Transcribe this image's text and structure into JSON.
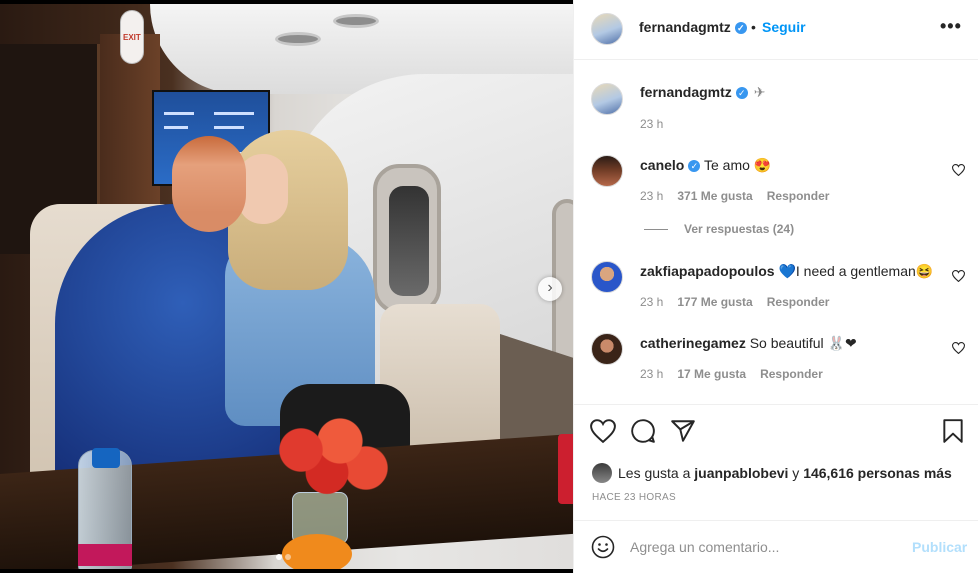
{
  "header": {
    "username": "fernandagmtz",
    "separator": "•",
    "follow_label": "Seguir",
    "more_label": "•••"
  },
  "caption": {
    "username": "fernandagmtz",
    "text": "✈",
    "time": "23 h"
  },
  "comments": [
    {
      "username": "canelo",
      "verified": true,
      "text": "Te amo 😍",
      "time": "23 h",
      "likes": "371 Me gusta",
      "reply": "Responder"
    },
    {
      "username": "zakfiapapadopoulos",
      "verified": false,
      "text": "💙I need a gentleman😆",
      "time": "23 h",
      "likes": "177 Me gusta",
      "reply": "Responder"
    },
    {
      "username": "catherinegamez",
      "verified": false,
      "text": "So beautiful 🐰❤",
      "time": "23 h",
      "likes": "17 Me gusta",
      "reply": "Responder"
    }
  ],
  "view_replies": "Ver respuestas (24)",
  "likes": {
    "prefix": "Les gusta a ",
    "user": "juanpablobevi",
    "middle": " y ",
    "count": "146,616 personas más"
  },
  "posted_ago": "HACE 23 HORAS",
  "add_comment": {
    "placeholder": "Agrega un comentario...",
    "publish_label": "Publicar"
  },
  "media": {
    "exit_sign": "EXIT",
    "next_arrow": "›",
    "slide_count": 2,
    "active_slide": 1
  },
  "colors": {
    "accent": "#0095f6",
    "verified": "#3897f0",
    "muted": "#8e8e8e",
    "publish_disabled": "#b2dffc"
  },
  "icons": [
    "heart-icon",
    "comment-icon",
    "share-icon",
    "bookmark-icon",
    "emoji-icon",
    "more-icon",
    "verified-icon",
    "next-icon",
    "plane-icon"
  ]
}
